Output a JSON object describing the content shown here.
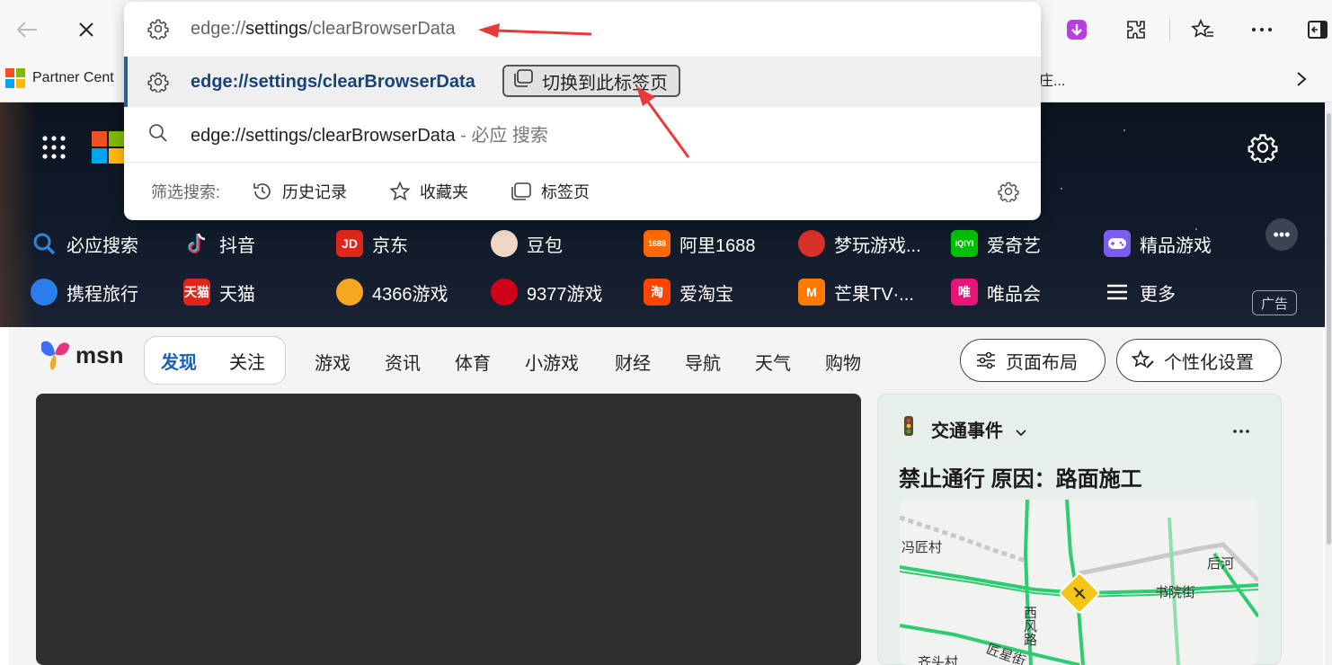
{
  "chrome": {
    "favorites_bar": {
      "partner_label": "Partner Cent",
      "truncated_item": "庄..."
    }
  },
  "omnibox": {
    "input": {
      "prefix": "edge://",
      "highlight": "settings",
      "suffix": "/clearBrowserData"
    },
    "selected_suggestion": {
      "text": "edge://settings/clearBrowserData",
      "switch_tab_label": "切换到此标签页"
    },
    "search_suggestion": {
      "text": "edge://settings/clearBrowserData",
      "suffix": " - 必应 搜索"
    },
    "filter": {
      "label": "筛选搜索:",
      "chips": [
        {
          "label": "历史记录",
          "icon": "history-icon"
        },
        {
          "label": "收藏夹",
          "icon": "star-icon"
        },
        {
          "label": "标签页",
          "icon": "tabs-icon"
        }
      ]
    }
  },
  "quick_links": {
    "row1": [
      {
        "label": "必应搜索",
        "icon": "search-icon",
        "color": "#2b88d8"
      },
      {
        "label": "抖音",
        "icon": "douyin-icon",
        "color": "#000000"
      },
      {
        "label": "京东",
        "icon": "jd-icon",
        "color": "#e1251b",
        "glyph": "JD"
      },
      {
        "label": "豆包",
        "icon": "doubao-icon",
        "color": "#f1d7c6"
      },
      {
        "label": "阿里1688",
        "icon": "1688-icon",
        "color": "#ff6a00",
        "glyph": "1688"
      },
      {
        "label": "梦玩游戏...",
        "icon": "mengwan-icon",
        "color": "#d8312a"
      },
      {
        "label": "爱奇艺",
        "icon": "iqiyi-icon",
        "color": "#00be06",
        "glyph": "iQIYI"
      },
      {
        "label": "精品游戏",
        "icon": "gamepad-icon",
        "color": "#7b5cf0"
      }
    ],
    "row2": [
      {
        "label": "携程旅行",
        "icon": "ctrip-icon",
        "color": "#2b7de9"
      },
      {
        "label": "天猫",
        "icon": "tmall-icon",
        "color": "#e0251b",
        "glyph": "天猫"
      },
      {
        "label": "4366游戏",
        "icon": "4366-icon",
        "color": "#f5a623"
      },
      {
        "label": "9377游戏",
        "icon": "9377-icon",
        "color": "#d0021b"
      },
      {
        "label": "爱淘宝",
        "icon": "taobao-icon",
        "color": "#ff4400",
        "glyph": "淘"
      },
      {
        "label": "芒果TV·...",
        "icon": "mango-icon",
        "color": "#ff7a00",
        "glyph": "M"
      },
      {
        "label": "唯品会",
        "icon": "vip-icon",
        "color": "#e5157a",
        "glyph": "唯"
      },
      {
        "label": "更多",
        "icon": "menu-icon",
        "color": "#ffffff"
      }
    ],
    "ad_badge": "广告"
  },
  "msn": {
    "logo_text": "msn",
    "tabs": [
      "发现",
      "关注"
    ],
    "nav_links": [
      "游戏",
      "资讯",
      "体育",
      "小游戏",
      "财经",
      "导航",
      "天气",
      "购物"
    ],
    "layout_button": "页面布局",
    "personalize_button": "个性化设置"
  },
  "traffic": {
    "title": "交通事件",
    "headline": "禁止通行 原因：路面施工",
    "map_labels": [
      "冯匠村",
      "后河",
      "书院街",
      "西风路",
      "匠星街",
      "齐头村"
    ]
  }
}
